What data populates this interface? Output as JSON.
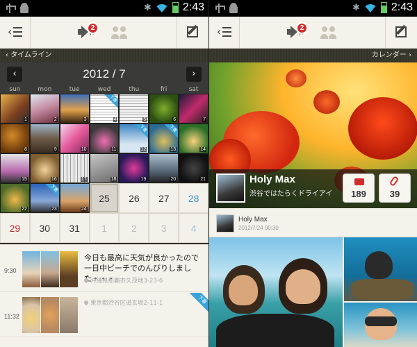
{
  "status_bar": {
    "time": "2:43"
  },
  "action_bar": {
    "notification_count": "2"
  },
  "left_screen": {
    "section_title": "タイムライン",
    "calendar": {
      "title": "2012 / 7",
      "weekdays": [
        "sun",
        "mon",
        "tue",
        "wed",
        "thu",
        "fri",
        "sat"
      ],
      "photo_days": [
        "1",
        "2",
        "3",
        "4",
        "5",
        "6",
        "7",
        "8",
        "9",
        "10",
        "11",
        "12",
        "13",
        "14",
        "15",
        "16",
        "17",
        "18",
        "19",
        "20",
        "21",
        "22",
        "23",
        "24"
      ],
      "tag_label": "下書",
      "empty_days": [
        {
          "day": "25",
          "type": "today"
        },
        {
          "day": "26",
          "type": "normal"
        },
        {
          "day": "27",
          "type": "normal"
        },
        {
          "day": "28",
          "type": "sat"
        },
        {
          "day": "29",
          "type": "sun"
        },
        {
          "day": "30",
          "type": "normal"
        },
        {
          "day": "31",
          "type": "normal"
        },
        {
          "day": "1",
          "type": "next"
        },
        {
          "day": "2",
          "type": "next"
        },
        {
          "day": "3",
          "type": "next"
        },
        {
          "day": "4",
          "type": "next"
        }
      ]
    },
    "timeline": [
      {
        "time": "9:30",
        "text": "今日も最高に天気が良かったので一日中ビーチでのんびりしました・・・",
        "place": "沖縄県那覇市久茂地3-23-6"
      },
      {
        "time": "11:32",
        "text": "",
        "place": "東京都渋谷区道玄坂2-11-1",
        "ribbon": "下書"
      }
    ]
  },
  "right_screen": {
    "section_title": "カレンダー",
    "profile": {
      "name": "Holy Max",
      "description": "渋谷ではたらくドライアイ",
      "photo_count": "189",
      "clip_count": "39"
    },
    "post": {
      "author": "Holy Max",
      "date": "2012/7/24 00:30"
    }
  },
  "colors": {
    "accent_blue": "#3aa3d8",
    "badge_red": "#d42a2a",
    "sunday_red": "#c83030",
    "saturday_blue": "#3c8fd0"
  }
}
